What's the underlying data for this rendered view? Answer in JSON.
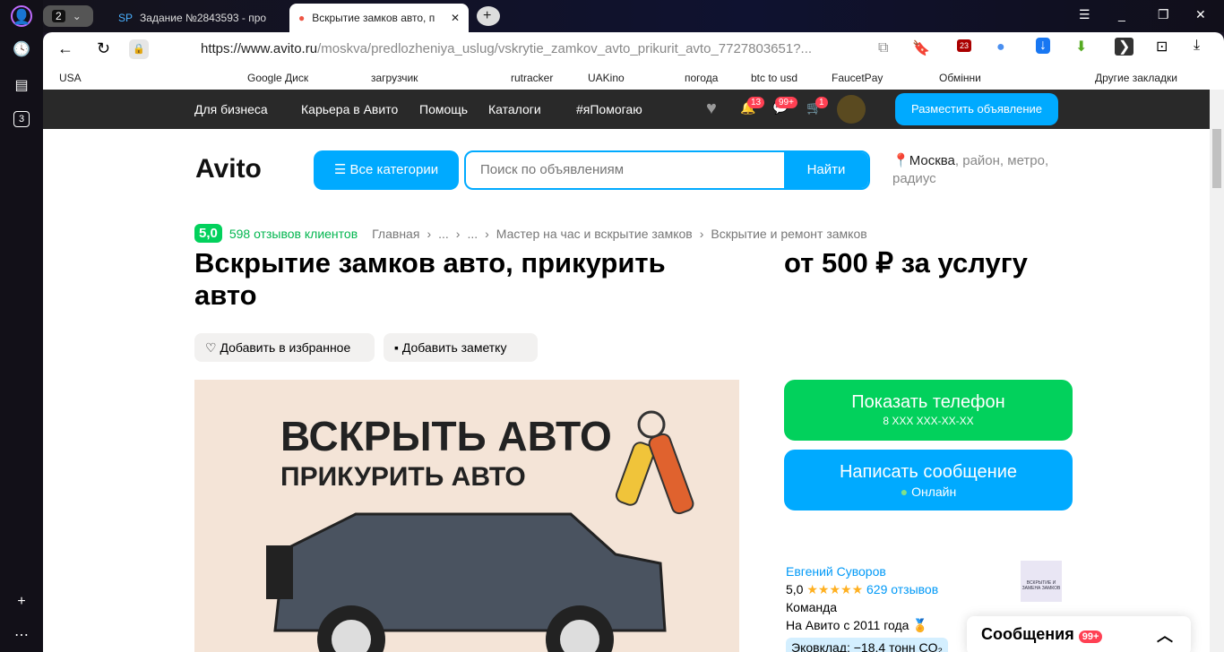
{
  "browser": {
    "tab_count": "2",
    "tabs": [
      {
        "icon": "SP",
        "title": "Задание №2843593 - про"
      },
      {
        "title": "Вскрытие замков авто, п"
      }
    ],
    "url_host": "https://www.avito.ru",
    "url_path": "/moskva/predlozheniya_uslug/vskrytie_zamkov_avto_prikurit_avto_7727803651?...",
    "sidebar_badge": "3",
    "ext_badge": "23",
    "bookmarks": [
      "USA",
      "Google Диск",
      "загрузчик",
      "rutracker",
      "UAKino",
      "погода",
      "btc to usd",
      "FaucetPay",
      "Обмінни",
      "Другие закладки"
    ]
  },
  "nav": {
    "items": [
      "Для бизнеса",
      "Карьера в Авито",
      "Помощь",
      "Каталоги",
      "#яПомогаю"
    ],
    "badges": {
      "notifications": "13",
      "messages": "99+",
      "cart": "1"
    },
    "post_button": "Разместить объявление"
  },
  "header": {
    "logo": "Avito",
    "all_categories": "Все категории",
    "search_placeholder": "Поиск по объявлениям",
    "search_button": "Найти",
    "location": "Москва",
    "location_hint": ", район, метро, радиус"
  },
  "breadcrumb": {
    "rating": "5,0",
    "reviews": "598 отзывов клиентов",
    "items": [
      "Главная",
      "...",
      "...",
      "Мастер на час и вскрытие замков",
      "Вскрытие и ремонт замков"
    ]
  },
  "listing": {
    "title": "Вскрытие замков авто, прикурить авто",
    "price": "от 500 ₽ за услугу",
    "add_favorite": "Добавить в избранное",
    "add_note": "Добавить заметку",
    "image_text1": "ВСКРЫТЬ АВТО",
    "image_text2": "ПРИКУРИТЬ АВТО"
  },
  "contact": {
    "show_phone": "Показать телефон",
    "phone_mask": "8 XXX XXX-XX-XX",
    "write": "Написать сообщение",
    "status": "Онлайн"
  },
  "seller": {
    "name": "Евгений Суворов",
    "rating": "5,0",
    "stars": "★★★★★",
    "reviews": "629 отзывов",
    "type": "Команда",
    "since": "На Авито с 2011 года",
    "eco": "Эковклад: −18,4 тонн CO₂",
    "logo_text": "ВСКРЫТИЕ И ЗАМЕНА ЗАМКОВ"
  },
  "messenger": {
    "label": "Сообщения",
    "badge": "99+"
  }
}
